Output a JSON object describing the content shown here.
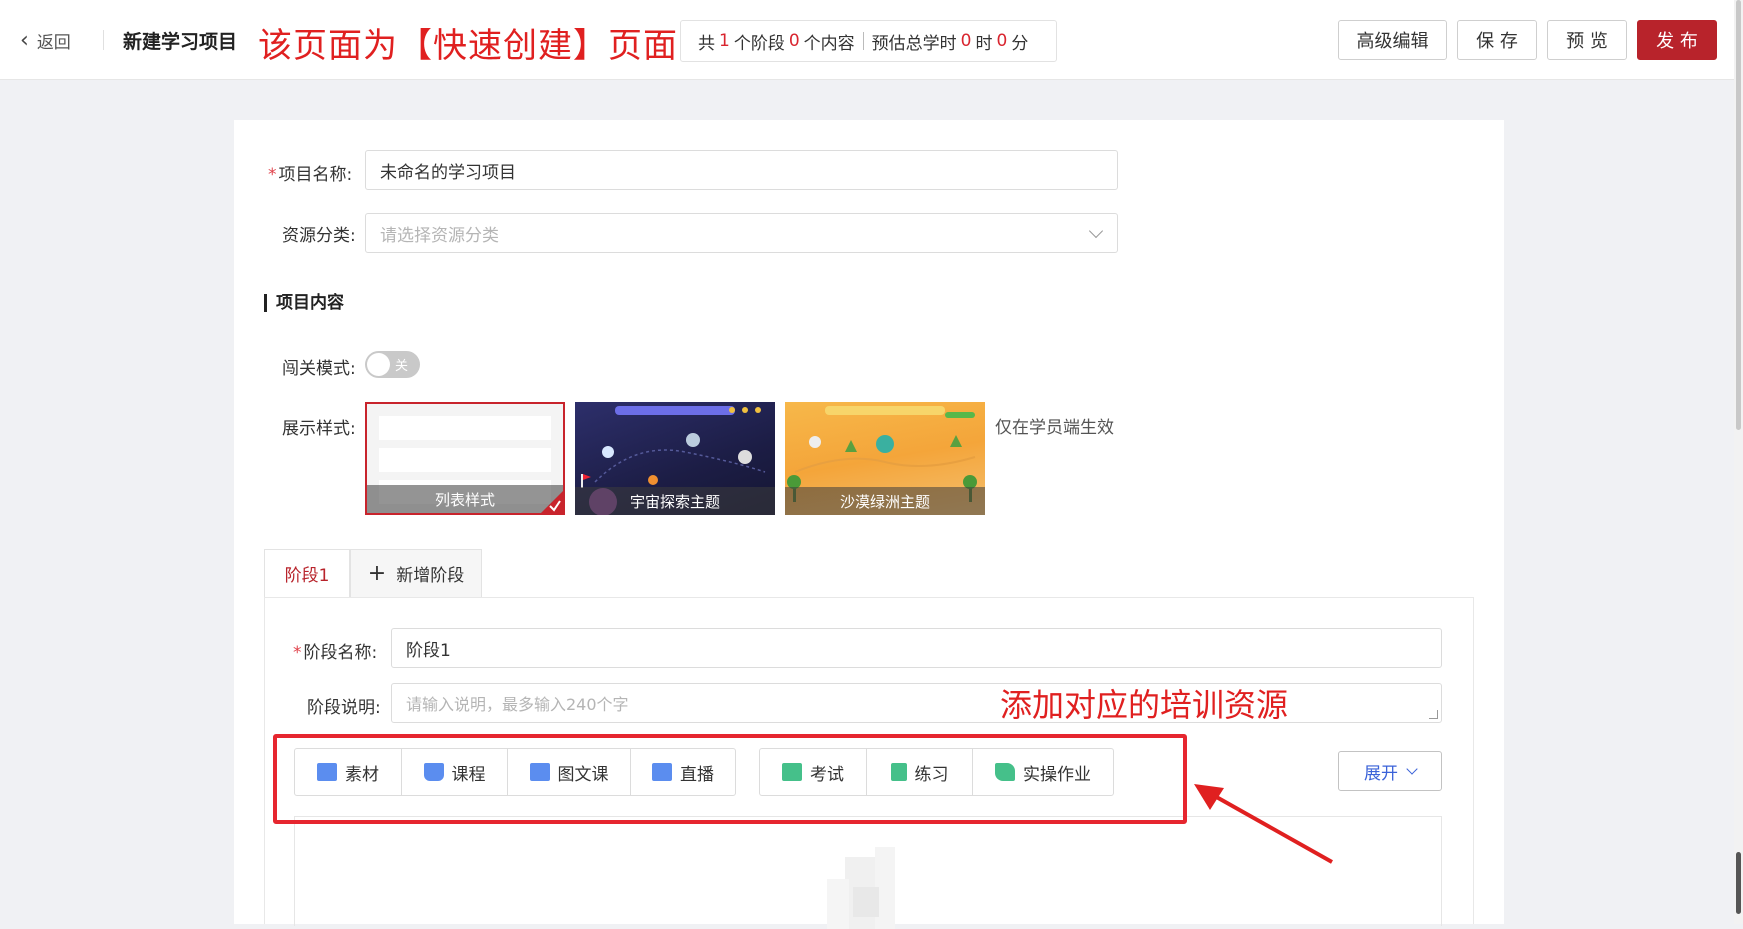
{
  "header": {
    "back_label": "返回",
    "page_title": "新建学习项目",
    "annotation": "该页面为【快速创建】页面",
    "stats": {
      "prefix": "共",
      "stage_count": "1",
      "stage_unit": "个阶段",
      "content_count": "0",
      "content_unit": "个内容",
      "est_label": "预估总学时",
      "hours": "0",
      "hours_unit": "时",
      "minutes": "0",
      "minutes_unit": "分"
    },
    "buttons": {
      "advanced": "高级编辑",
      "save": "保 存",
      "preview": "预 览",
      "publish": "发 布"
    }
  },
  "form": {
    "name_label": "项目名称:",
    "name_value": "未命名的学习项目",
    "category_label": "资源分类:",
    "category_placeholder": "请选择资源分类",
    "section_title": "项目内容",
    "mode_label": "闯关模式:",
    "mode_state": "关",
    "style_label": "展示样式:",
    "styles": [
      {
        "caption": "列表样式",
        "selected": true
      },
      {
        "caption": "宇宙探索主题",
        "selected": false
      },
      {
        "caption": "沙漠绿洲主题",
        "selected": false
      }
    ],
    "style_note": "仅在学员端生效"
  },
  "stage": {
    "tabs": [
      {
        "label": "阶段1"
      },
      {
        "label": "新增阶段"
      }
    ],
    "name_label": "阶段名称:",
    "name_value": "阶段1",
    "desc_label": "阶段说明:",
    "desc_placeholder": "请输入说明，最多输入240个字",
    "annotation": "添加对应的培训资源",
    "resources_a": [
      {
        "label": "素材",
        "icon": "folder-icon",
        "color": "#5b8def"
      },
      {
        "label": "课程",
        "icon": "book-icon",
        "color": "#5b8def"
      },
      {
        "label": "图文课",
        "icon": "image-icon",
        "color": "#5b8def"
      },
      {
        "label": "直播",
        "icon": "live-icon",
        "color": "#5b8def"
      }
    ],
    "resources_b": [
      {
        "label": "考试",
        "icon": "exam-icon",
        "color": "#45c08a"
      },
      {
        "label": "练习",
        "icon": "practice-icon",
        "color": "#45c08a"
      },
      {
        "label": "实操作业",
        "icon": "homework-icon",
        "color": "#45c08a"
      }
    ],
    "expand_label": "展开"
  },
  "colors": {
    "brand": "#b8232b",
    "annotation": "#e02020",
    "link": "#3a62d8"
  }
}
